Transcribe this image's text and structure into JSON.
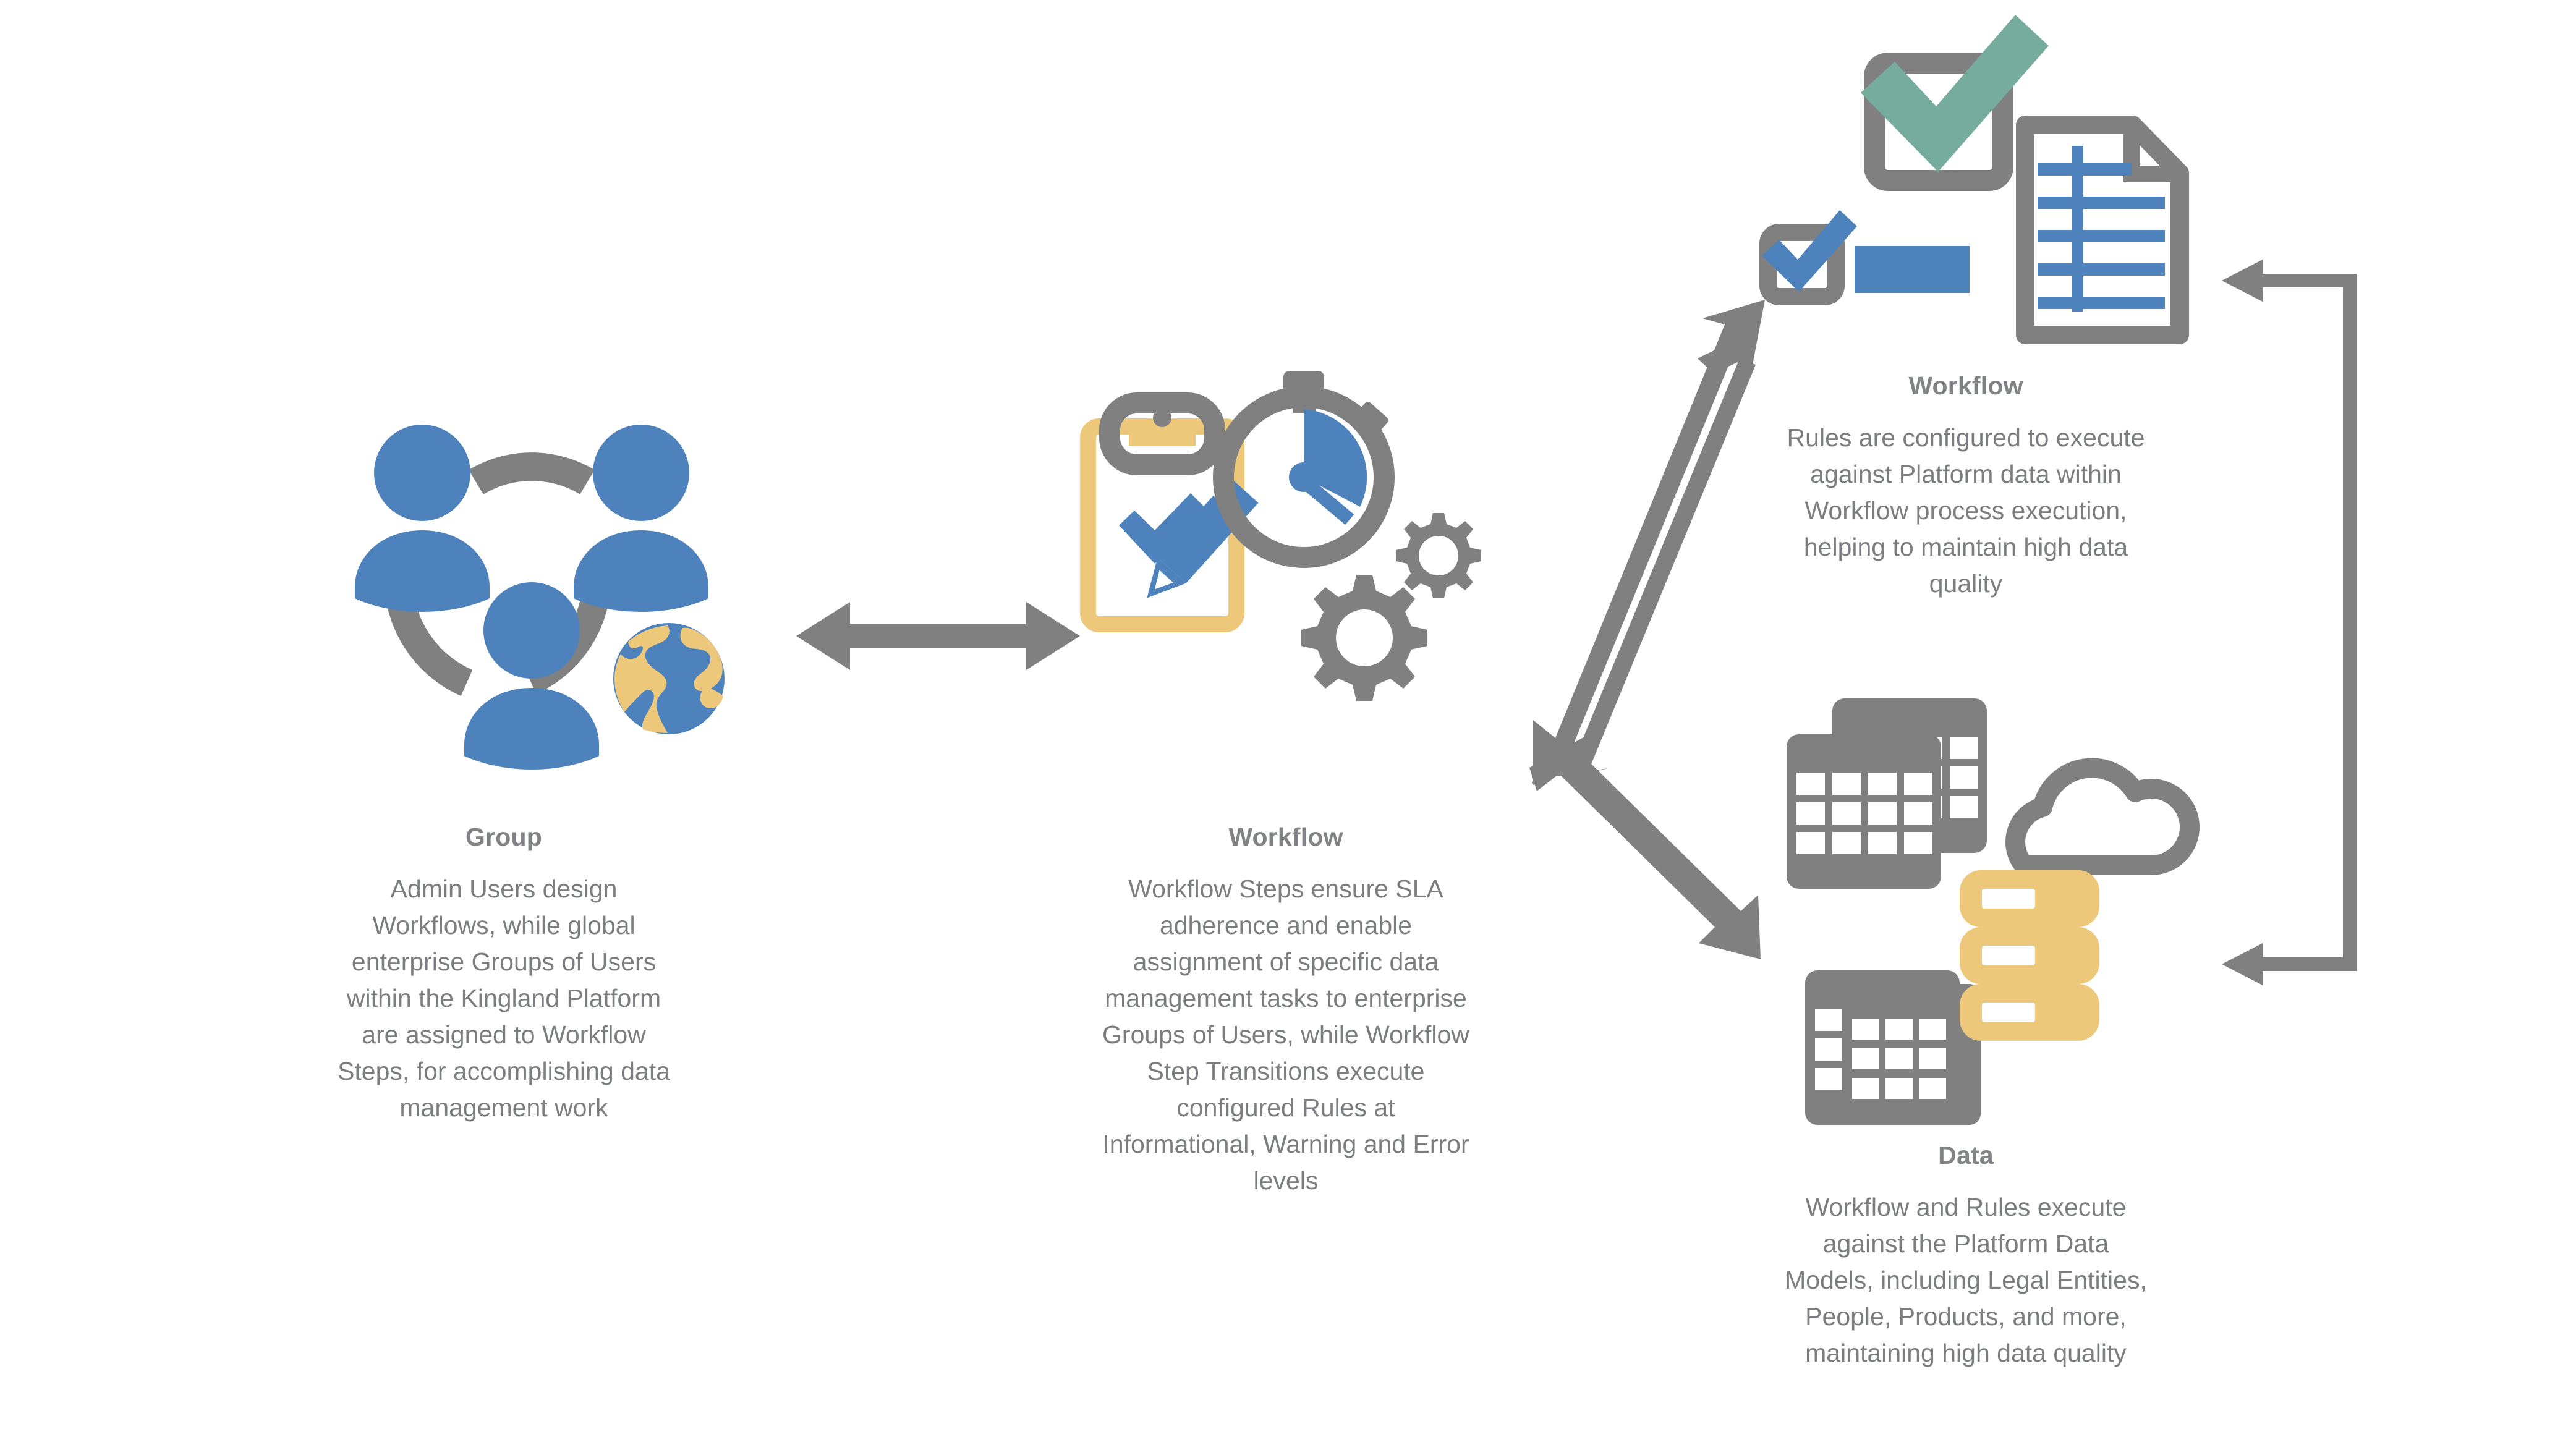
{
  "palette": {
    "blue": "#4E82BC",
    "gray": "#808080",
    "text_gray": "#7b7d80",
    "title_gray": "#808285",
    "yellow": "#EDC87B",
    "green": "#76AC9B",
    "white": "#ffffff",
    "background": "#ffffff"
  },
  "nodes": {
    "group": {
      "title": "Group",
      "description": "Admin Users design Workflows, while global enterprise Groups of Users within the Kingland Platform are assigned to Workflow Steps, for accomplishing data management work",
      "icon_name": "group-of-users-globe-icon"
    },
    "workflow_center": {
      "title": "Workflow",
      "description": "Workflow Steps ensure SLA adherence and enable assignment of specific data management tasks to enterprise Groups of Users, while Workflow Step Transitions execute configured Rules at Informational, Warning and Error levels",
      "icon_name": "clipboard-stopwatch-gears-icon"
    },
    "workflow_right": {
      "title": "Workflow",
      "description": "Rules are configured to execute against Platform data within Workflow process execution, helping to maintain high data quality",
      "icon_name": "checkbox-document-icon"
    },
    "data": {
      "title": "Data",
      "description": "Workflow and Rules execute against the Platform Data Models, including Legal Entities, People, Products, and more, maintaining high data quality",
      "icon_name": "spreadsheets-cloud-database-icon"
    }
  },
  "connectors": [
    {
      "name": "group-to-workflow-arrow",
      "style": "double-headed-horizontal"
    },
    {
      "name": "workflow-to-rules-arrow",
      "style": "double-headed-diagonal-up"
    },
    {
      "name": "workflow-to-data-arrow",
      "style": "double-headed-diagonal-down"
    },
    {
      "name": "rules-data-bracket",
      "style": "bracket-two-left-arrowheads"
    }
  ]
}
